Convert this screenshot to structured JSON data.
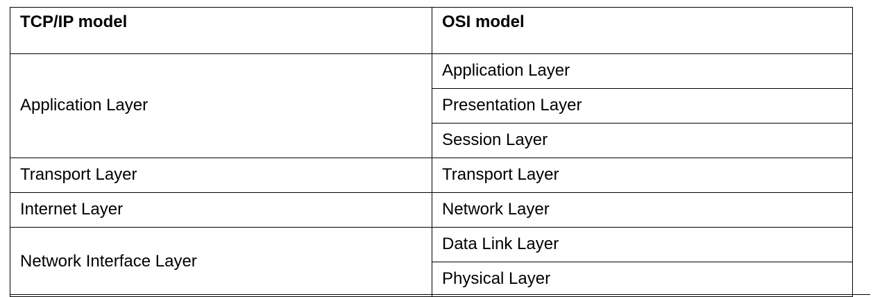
{
  "table": {
    "headers": {
      "tcpip": "TCP/IP model",
      "osi": "OSI model"
    },
    "tcpip_layers": {
      "application": "Application Layer",
      "transport": "Transport Layer",
      "internet": "Internet Layer",
      "network_interface": "Network Interface Layer"
    },
    "osi_layers": [
      "Application Layer",
      "Presentation Layer",
      "Session Layer",
      "Transport Layer",
      "Network Layer",
      "Data Link Layer",
      "Physical Layer"
    ]
  }
}
